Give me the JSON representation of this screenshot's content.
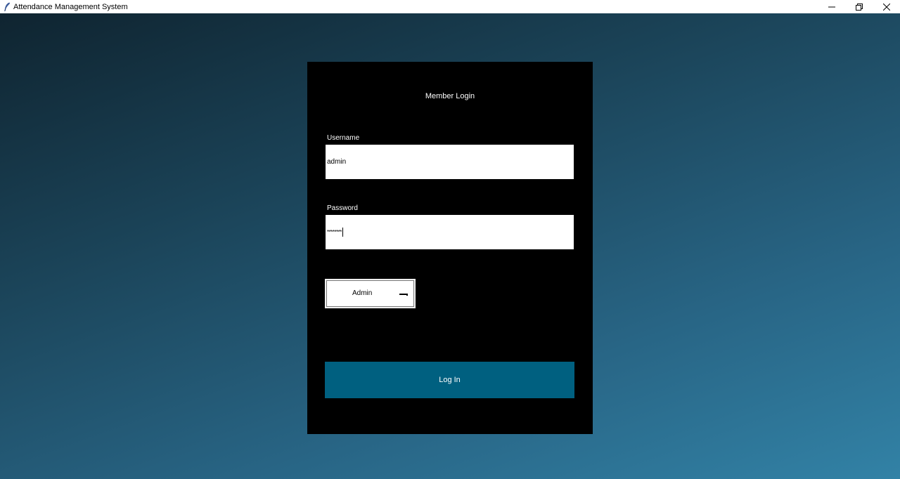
{
  "window": {
    "title": "Attendance Management System"
  },
  "login": {
    "heading": "Member Login",
    "username": {
      "label": "Username",
      "value": "admin"
    },
    "password": {
      "label": "Password",
      "value": "********"
    },
    "role": {
      "selected": "Admin"
    },
    "submit_label": "Log In"
  },
  "colors": {
    "card_background": "#000000",
    "login_button": "#006080",
    "background_gradient_start": "#0f2430",
    "background_gradient_end": "#3282a6"
  },
  "icons": {
    "app": "feather-icon",
    "minimize": "minimize-icon",
    "restore": "restore-icon",
    "close": "close-icon",
    "dropdown": "dropdown-indicator-icon"
  }
}
